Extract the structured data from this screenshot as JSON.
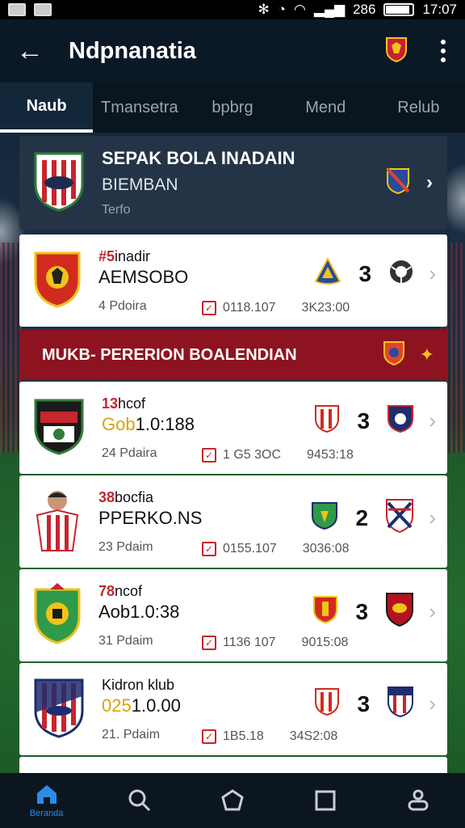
{
  "status_bar": {
    "battery_text": "286",
    "time": "17:07"
  },
  "app_bar": {
    "title": "Ndpnanatia"
  },
  "tabs": [
    {
      "label": "Naub",
      "active": true
    },
    {
      "label": "Tmansetra",
      "active": false
    },
    {
      "label": "bpbrg",
      "active": false
    },
    {
      "label": "Mend",
      "active": false
    },
    {
      "label": "Relub",
      "active": false
    }
  ],
  "league": {
    "title": "SEPAK BOLA INADAIN",
    "subtitle": "BIEMBAN",
    "season": "Terfo"
  },
  "top_card": {
    "rank": "#5",
    "rank_rest": "inadir",
    "name": "AEMSOBO",
    "played": "4 Pdoira",
    "date": "0118.107",
    "time": "3K23:00",
    "score": "3"
  },
  "section": {
    "title": "MUKB- PERERION BOALENDIAN"
  },
  "cards": [
    {
      "rank": "13",
      "rank_rest": "hcof",
      "name_yellow": "Gob",
      "name_rest": "1.0:188",
      "played": "24 Pdaira",
      "date": "1 G5 3OC",
      "time": "9453:18",
      "score": "3"
    },
    {
      "rank": "38",
      "rank_rest": "bocfia",
      "name_yellow": "",
      "name_rest": "PPERKO.NS",
      "played": "23 Pdaim",
      "date": "0155.107",
      "time": "3036:08",
      "score": "2"
    },
    {
      "rank": "78",
      "rank_rest": "ncof",
      "name_yellow": "",
      "name_rest": "Aob1.0:38",
      "played": "31 Pdaim",
      "date": "1136 107",
      "time": "9015:08",
      "score": "3"
    },
    {
      "rank": "",
      "rank_rest": "Kidron klub",
      "name_yellow": "025",
      "name_rest": "1.0.00",
      "played": "21. Pdaim",
      "date": "1B5.18",
      "time": "34S2:08",
      "score": "3"
    }
  ],
  "bottom_nav": {
    "active_label": "Beranda"
  },
  "colors": {
    "accent": "#2b8ce6",
    "banner": "#8e1320",
    "rank_red": "#c6262e"
  }
}
